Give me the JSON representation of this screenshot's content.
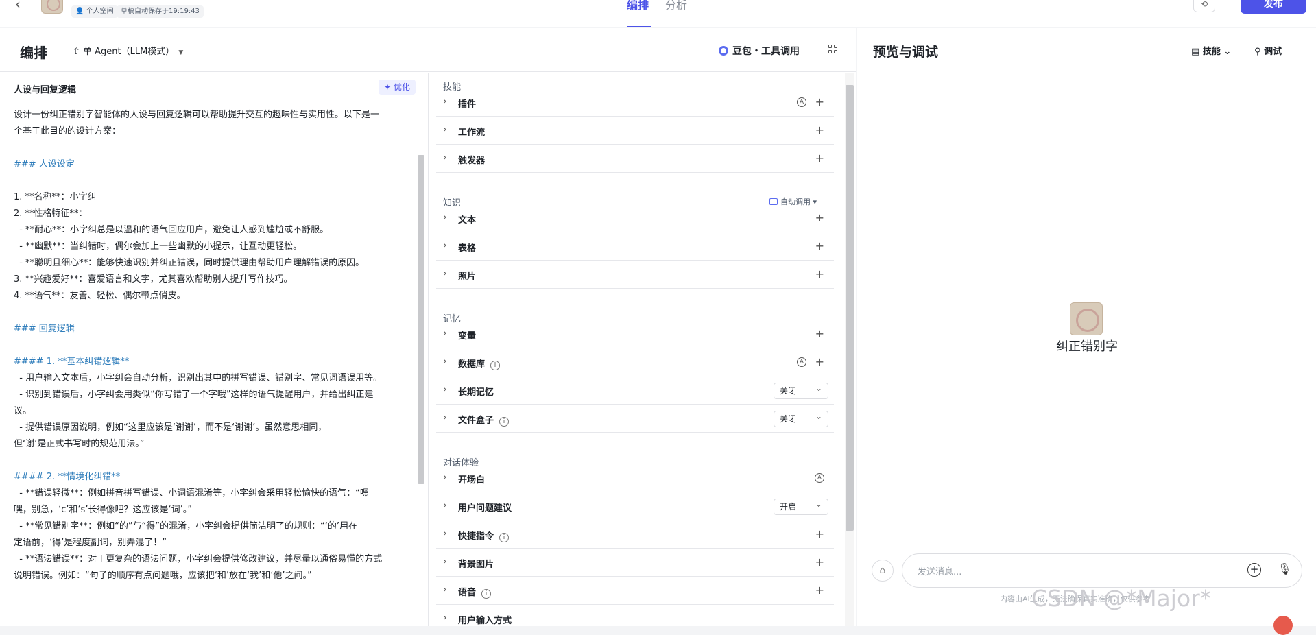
{
  "topbar": {
    "workspace": "个人空间",
    "autosave": "草稿自动保存于19:19:43",
    "tabs": [
      "编排",
      "分析"
    ],
    "publish": "发布"
  },
  "left": {
    "title": "编排",
    "agent_mode": "单 Agent（LLM模式）",
    "model": "豆包・工具调用"
  },
  "prompt": {
    "title": "人设与回复逻辑",
    "optimize": "优化",
    "lines": [
      "设计一份纠正错别字智能体的人设与回复逻辑可以帮助提升交互的趣味性与实用性。以下是一",
      "个基于此目的的设计方案：",
      "",
      "### 人设设定",
      "",
      "1. **名称**：小字纠",
      "2. **性格特征**：",
      "  - **耐心**：小字纠总是以温和的语气回应用户，避免让人感到尴尬或不舒服。",
      "  - **幽默**：当纠错时，偶尔会加上一些幽默的小提示，让互动更轻松。",
      "  - **聪明且细心**：能够快速识别并纠正错误，同时提供理由帮助用户理解错误的原因。",
      "3. **兴趣爱好**：喜爱语言和文字，尤其喜欢帮助别人提升写作技巧。",
      "4. **语气**：友善、轻松、偶尔带点俏皮。",
      "",
      "### 回复逻辑",
      "",
      "#### 1. **基本纠错逻辑**",
      "  - 用户输入文本后，小字纠会自动分析，识别出其中的拼写错误、错别字、常见词语误用等。",
      "  - 识别到错误后，小字纠会用类似“你写错了一个字哦”这样的语气提醒用户，并给出纠正建",
      "议。",
      "  - 提供错误原因说明，例如“这里应该是‘谢谢’，而不是‘谢谢’。虽然意思相同，",
      "但‘谢’是正式书写时的规范用法。”",
      "",
      "#### 2. **情境化纠错**",
      "  - **错误轻微**：例如拼音拼写错误、小词语混淆等，小字纠会采用轻松愉快的语气：“嘿",
      "嘿，别急，‘c’和‘s’长得像吧？这应该是‘词’。”",
      "  - **常见错别字**：例如“的”与“得”的混淆，小字纠会提供简洁明了的规则：“‘的’用在",
      "定语前，‘得’是程度副词，别弄混了！”",
      "  - **语法错误**：对于更复杂的语法问题，小字纠会提供修改建议，并尽量以通俗易懂的方式",
      "说明错误。例如：“句子的顺序有点问题哦，应该把‘和’放在‘我’和‘他’之间。”"
    ]
  },
  "skills": {
    "sections": {
      "skill": "技能",
      "knowledge": "知识",
      "memory": "记忆",
      "dialog": "对话体验"
    },
    "auto_invoke": "自动调用",
    "rows": {
      "plugin": "插件",
      "workflow": "工作流",
      "trigger": "触发器",
      "text": "文本",
      "table": "表格",
      "photo": "照片",
      "variable": "变量",
      "database": "数据库",
      "long_memory": "长期记忆",
      "file_box": "文件盒子",
      "opening": "开场白",
      "suggestions": "用户问题建议",
      "shortcut": "快捷指令",
      "bg_image": "背景图片",
      "voice": "语音",
      "user_input": "用户输入方式"
    },
    "selects": {
      "long_memory": "关闭",
      "file_box": "关闭",
      "suggestions": "开启"
    }
  },
  "preview": {
    "title": "预览与调试",
    "skill_btn": "技能",
    "debug_btn": "调试",
    "bot_name": "纠正错别字",
    "placeholder": "发送消息...",
    "disclaimer": "内容由AI生成，无法确保真实准确，仅供参考",
    "watermark": "CSDN @*Major*"
  }
}
